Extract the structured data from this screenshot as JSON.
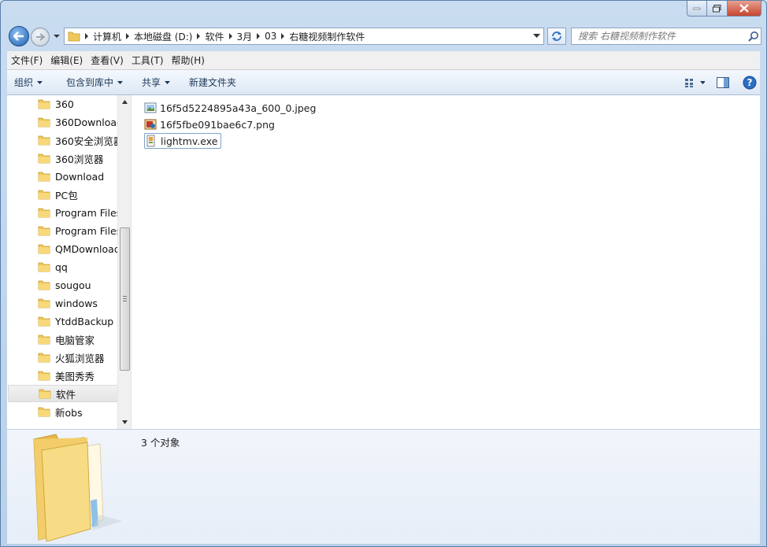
{
  "window": {
    "path": [
      "计算机",
      "本地磁盘 (D:)",
      "软件",
      "3月",
      "03",
      "右糖视频制作软件"
    ],
    "search_placeholder": "搜索 右糖视频制作软件"
  },
  "menubar": [
    "文件(F)",
    "编辑(E)",
    "查看(V)",
    "工具(T)",
    "帮助(H)"
  ],
  "toolbar": {
    "organize": "组织",
    "include_library": "包含到库中",
    "share": "共享",
    "new_folder": "新建文件夹"
  },
  "tree": [
    {
      "label": "360"
    },
    {
      "label": "360Download"
    },
    {
      "label": "360安全浏览器"
    },
    {
      "label": "360浏览器"
    },
    {
      "label": "Download"
    },
    {
      "label": "PC包"
    },
    {
      "label": "Program Files"
    },
    {
      "label": "Program Files"
    },
    {
      "label": "QMDownload"
    },
    {
      "label": "qq"
    },
    {
      "label": "sougou"
    },
    {
      "label": "windows"
    },
    {
      "label": "YtddBackup"
    },
    {
      "label": "电脑管家"
    },
    {
      "label": "火狐浏览器"
    },
    {
      "label": "美图秀秀"
    },
    {
      "label": "软件",
      "selected": true
    },
    {
      "label": "新obs"
    }
  ],
  "files": [
    {
      "name": "16f5d5224895a43a_600_0.jpeg",
      "icon": "jpeg-image-icon"
    },
    {
      "name": "16f5fbe091bae6c7.png",
      "icon": "png-image-icon"
    },
    {
      "name": "lightmv.exe",
      "icon": "exe-app-icon",
      "focused": true
    }
  ],
  "details": {
    "count": "3 个对象"
  }
}
